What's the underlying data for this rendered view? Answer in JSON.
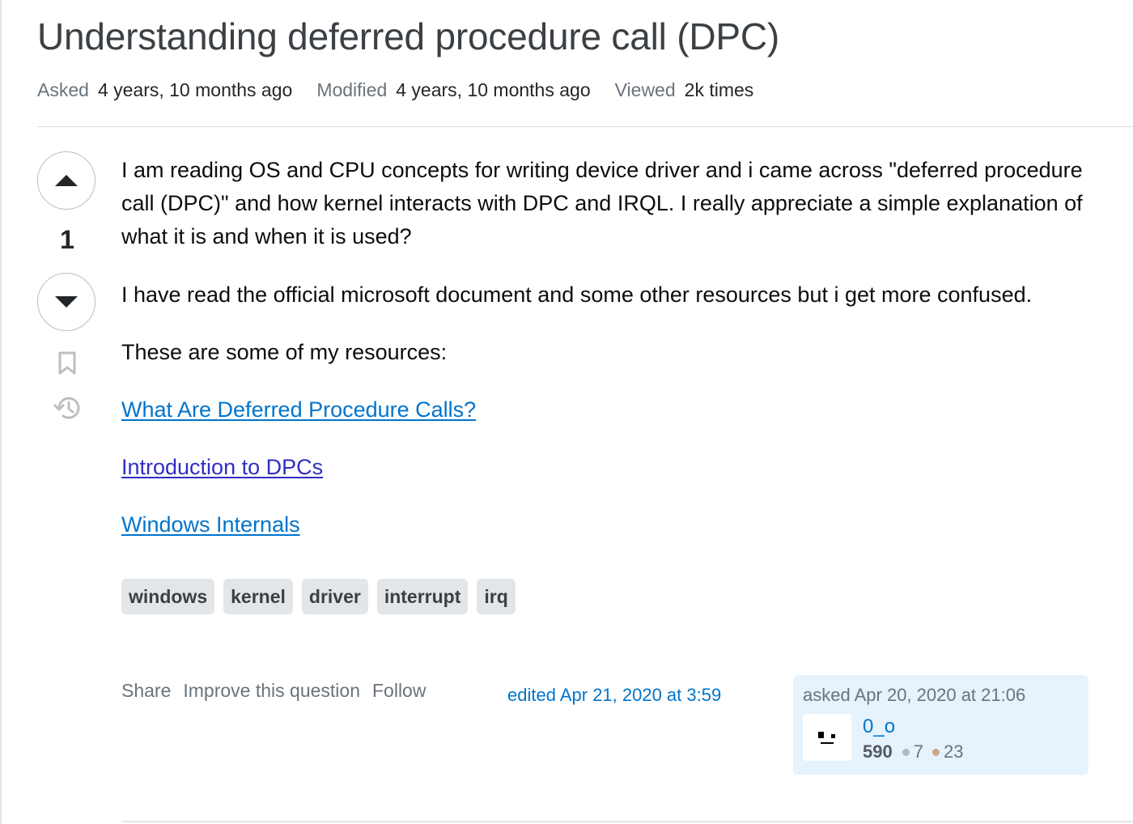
{
  "question": {
    "title": "Understanding deferred procedure call (DPC)",
    "meta": {
      "asked_label": "Asked",
      "asked_value": "4 years, 10 months ago",
      "modified_label": "Modified",
      "modified_value": "4 years, 10 months ago",
      "viewed_label": "Viewed",
      "viewed_value": "2k times"
    },
    "votes": {
      "count": "1"
    },
    "body": {
      "paragraphs": [
        "I am reading OS and CPU concepts for writing device driver and i came across \"deferred procedure call (DPC)\" and how kernel interacts with DPC and IRQL. I really appreciate a simple explanation of what it is and when it is used?",
        "I have read the official microsoft document and some other resources but i get more confused.",
        "These are some of my resources:"
      ],
      "links": [
        "What Are Deferred Procedure Calls?",
        "Introduction to DPCs",
        "Windows Internals"
      ]
    },
    "tags": [
      "windows",
      "kernel",
      "driver",
      "interrupt",
      "irq"
    ],
    "menu": {
      "share": "Share",
      "improve": "Improve this question",
      "follow": "Follow"
    },
    "edited": "edited Apr 21, 2020 at 3:59",
    "owner": {
      "asked": "asked Apr 20, 2020 at 21:06",
      "name": "0_o",
      "reputation": "590",
      "silver_badges": "7",
      "bronze_badges": "23"
    }
  },
  "colors": {
    "link": "#0074cc",
    "visited_link": "#2f2ec5",
    "tag_bg": "#e3e6e8",
    "owner_card_bg": "#e6f2fc",
    "silver": "#b4b8bc",
    "bronze": "#d1a684"
  },
  "icons": [
    "vote-up-icon",
    "vote-down-icon",
    "bookmark-icon",
    "history-icon"
  ]
}
